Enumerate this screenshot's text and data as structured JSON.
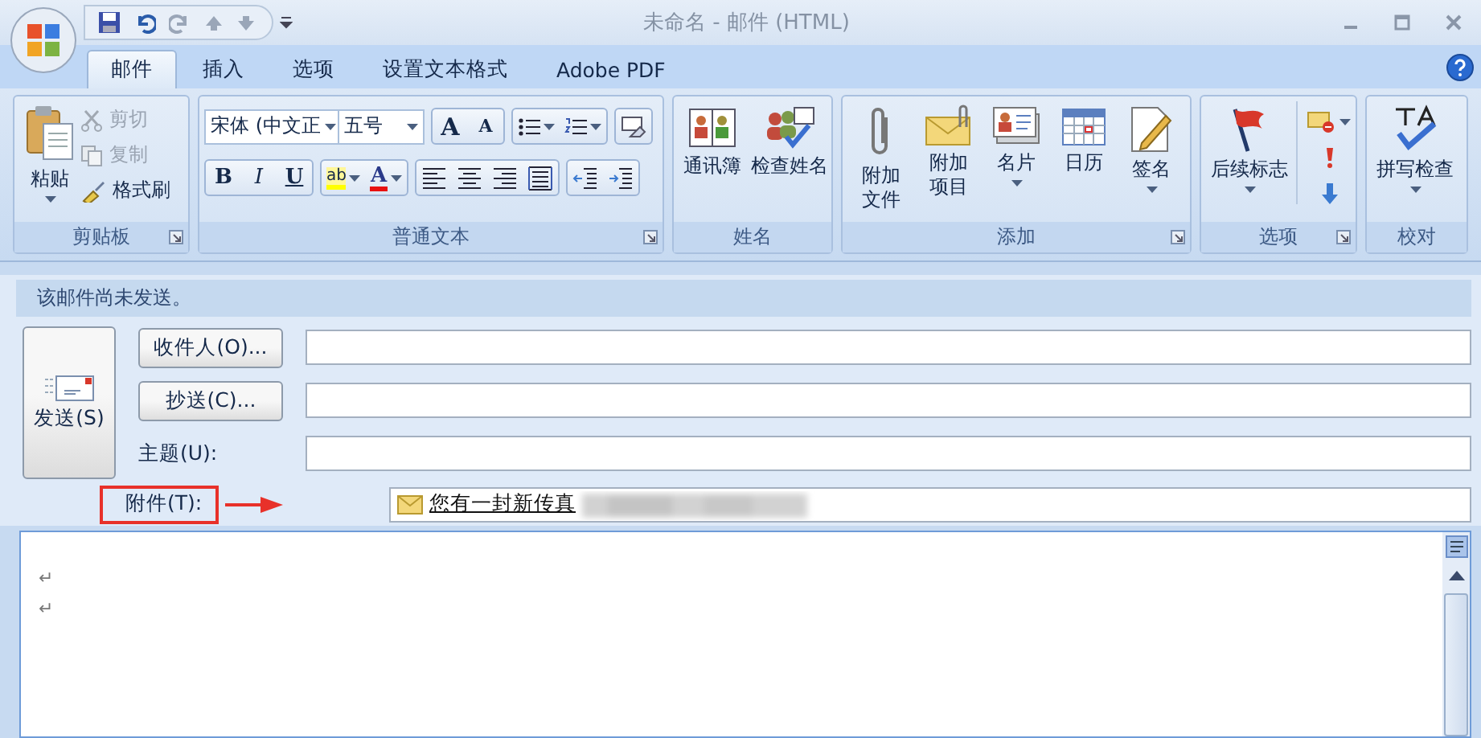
{
  "window": {
    "title": "未命名 - 邮件 (HTML)"
  },
  "tabs": [
    {
      "label": "邮件",
      "selected": true
    },
    {
      "label": "插入",
      "selected": false
    },
    {
      "label": "选项",
      "selected": false
    },
    {
      "label": "设置文本格式",
      "selected": false
    },
    {
      "label": "Adobe PDF",
      "selected": false
    }
  ],
  "ribbon": {
    "clipboard": {
      "title": "剪贴板",
      "paste": "粘贴",
      "cut": {
        "label": "剪切",
        "disabled": true
      },
      "copy": {
        "label": "复制",
        "disabled": true
      },
      "format_painter": {
        "label": "格式刷",
        "disabled": false
      }
    },
    "basic_text": {
      "title": "普通文本",
      "font_name": "宋体 (中文正",
      "font_size": "五号",
      "grow_font": "A",
      "shrink_font": "A",
      "bold": "B",
      "italic": "I",
      "underline": "U",
      "highlight": "ab",
      "font_color": "A"
    },
    "names": {
      "title": "姓名",
      "buttons": [
        "通讯簿",
        "检查姓名"
      ]
    },
    "include": {
      "title": "添加",
      "buttons": [
        {
          "label": "附加文件",
          "caret": false
        },
        {
          "label": "附加项目",
          "caret": false
        },
        {
          "label": "名片",
          "caret": true
        },
        {
          "label": "日历",
          "caret": false
        },
        {
          "label": "签名",
          "caret": true
        }
      ]
    },
    "options": {
      "title": "选项",
      "follow_up": "后续标志"
    },
    "proofing": {
      "title": "校对",
      "spelling": "拼写检查"
    }
  },
  "info_bar": "该邮件尚未发送。",
  "send_button": "发送(S)",
  "header_fields": [
    {
      "kind": "button",
      "label": "收件人(O)..."
    },
    {
      "kind": "button",
      "label": "抄送(C)..."
    },
    {
      "kind": "label",
      "label": "主题(U):"
    }
  ],
  "attachments": {
    "label": "附件(T):",
    "files": [
      "您有一封新传真"
    ]
  },
  "body": {
    "paragraph_marks": [
      "↵",
      "↵"
    ]
  }
}
